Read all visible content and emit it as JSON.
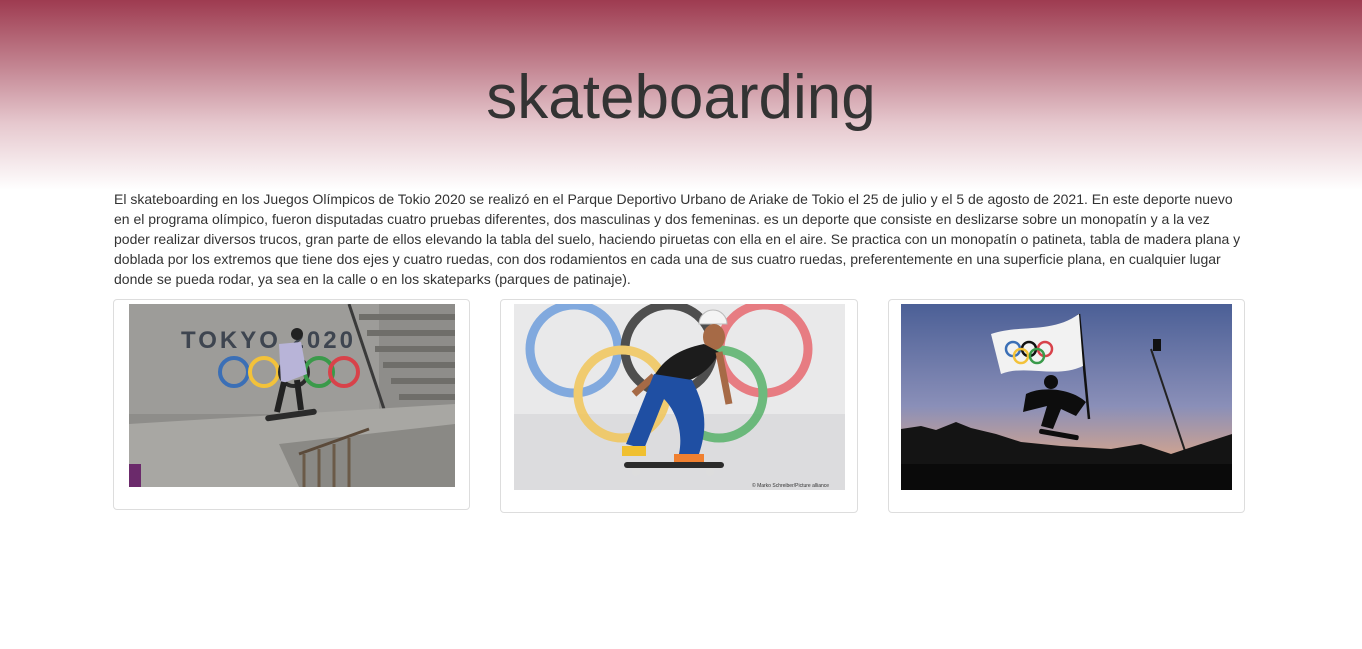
{
  "header": {
    "title": "skateboarding"
  },
  "intro": {
    "text": "El skateboarding en los Juegos Olímpicos de Tokio 2020 se realizó en el Parque Deportivo Urbano de Ariake de Tokio el 25 de julio y el 5 de agosto de 2021. En este deporte nuevo en el programa olímpico, fueron disputadas cuatro pruebas diferentes, dos masculinas y dos femeninas. es un deporte que consiste en deslizarse sobre un monopatín y a la vez poder realizar diversos trucos, gran parte de ellos elevando la tabla del suelo, haciendo piruetas con ella en el aire. Se practica con un monopatín o patineta, tabla de madera plana y doblada por los extremos que tiene dos ejes y cuatro ruedas, con dos rodamientos en cada una de sus cuatro ruedas, preferentemente en una superficie plana, en cualquier lugar donde se pueda rodar, ya sea en la calle o en los skateparks (parques de patinaje)."
  },
  "gallery": [
    {
      "wall_text": "TOKYO 2020"
    },
    {
      "credit": "© Marko Schreiber/Picture alliance"
    },
    {
      "sky": "sunset"
    }
  ],
  "colors": {
    "header_top": "#9e3b50",
    "text": "#333333",
    "card_border": "#dddddd"
  }
}
